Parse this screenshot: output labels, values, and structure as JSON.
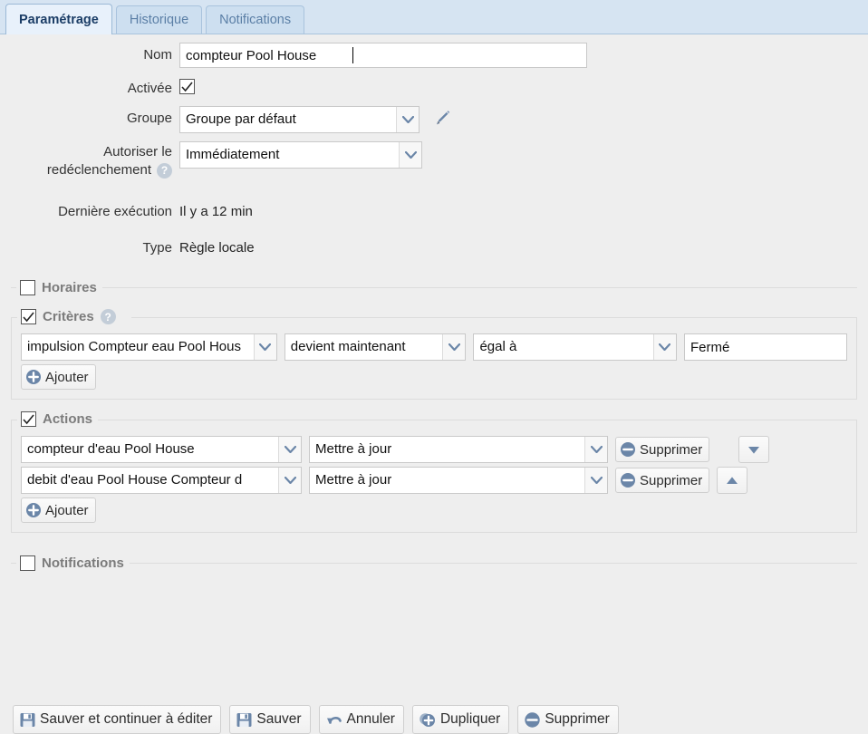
{
  "tabs": [
    {
      "label": "Paramétrage",
      "active": true
    },
    {
      "label": "Historique",
      "active": false
    },
    {
      "label": "Notifications",
      "active": false
    }
  ],
  "form": {
    "nom_label": "Nom",
    "nom_value": "compteur Pool House",
    "activee_label": "Activée",
    "activee_checked": true,
    "groupe_label": "Groupe",
    "groupe_value": "Groupe par défaut",
    "autoriser_label_line1": "Autoriser le",
    "autoriser_label_line2": "redéclenchement",
    "autoriser_value": "Immédiatement",
    "derniere_label": "Dernière exécution",
    "derniere_value": "Il y a 12 min",
    "type_label": "Type",
    "type_value": "Règle locale",
    "help_glyph": "?"
  },
  "horaires": {
    "legend": "Horaires",
    "checked": false
  },
  "criteres": {
    "legend": "Critères",
    "checked": true,
    "has_help": true,
    "rows": [
      {
        "subject": "impulsion Compteur eau Pool Hous",
        "event": "devient maintenant",
        "operator": "égal à",
        "value": "Fermé"
      }
    ],
    "add_label": "Ajouter"
  },
  "actions": {
    "legend": "Actions",
    "checked": true,
    "rows": [
      {
        "target": "compteur d'eau Pool House",
        "operation": "Mettre à jour",
        "remove_label": "Supprimer",
        "move": "down"
      },
      {
        "target": "debit d'eau Pool House Compteur d",
        "operation": "Mettre à jour",
        "remove_label": "Supprimer",
        "move": "up"
      }
    ],
    "add_label": "Ajouter"
  },
  "notifications": {
    "legend": "Notifications",
    "checked": false
  },
  "toolbar": {
    "save_continue_label": "Sauver et continuer à éditer",
    "save_label": "Sauver",
    "cancel_label": "Annuler",
    "duplicate_label": "Dupliquer",
    "delete_label": "Supprimer"
  },
  "colors": {
    "page_bg": "#eeeeee",
    "tabbar_bg": "#d6e4f2",
    "tab_active_bg": "#e8f1fb",
    "tab_active_text": "#1b3d66",
    "tab_text": "#5b7fa6",
    "legend_text": "#7b7b7b",
    "icon_blue": "#6b86a8",
    "border": "#dcdcdc"
  }
}
